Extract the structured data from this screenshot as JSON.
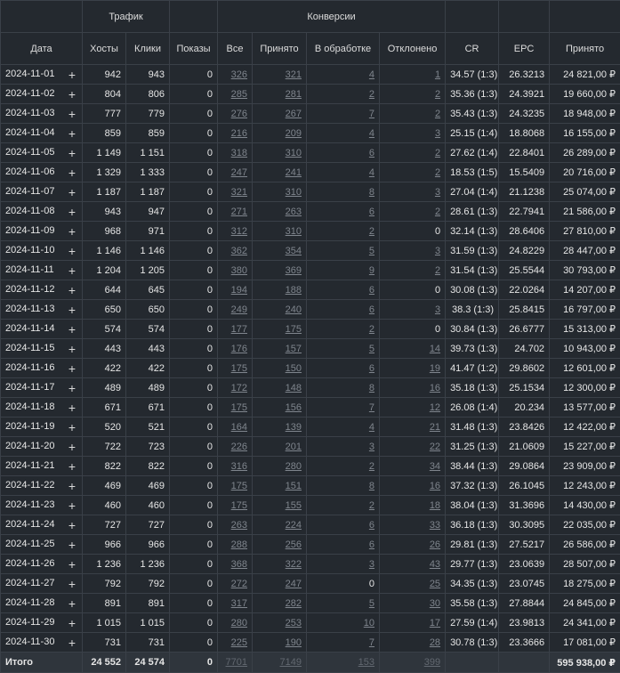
{
  "groups": {
    "traffic": "Трафик",
    "conversions": "Конверсии"
  },
  "columns": [
    "Дата",
    "Хосты",
    "Клики",
    "Показы",
    "Все",
    "Принято",
    "В обработке",
    "Отклонено",
    "CR",
    "EPC",
    "Принято"
  ],
  "rows": [
    {
      "date": "2024-11-01",
      "hosts": "942",
      "clicks": "943",
      "shows": "0",
      "all": "326",
      "accepted": "321",
      "pending": "4",
      "rejected": "1",
      "cr": "34.57 (1:3)",
      "epc": "26.3213",
      "revenue": "24 821,00 ₽"
    },
    {
      "date": "2024-11-02",
      "hosts": "804",
      "clicks": "806",
      "shows": "0",
      "all": "285",
      "accepted": "281",
      "pending": "2",
      "rejected": "2",
      "cr": "35.36 (1:3)",
      "epc": "24.3921",
      "revenue": "19 660,00 ₽"
    },
    {
      "date": "2024-11-03",
      "hosts": "777",
      "clicks": "779",
      "shows": "0",
      "all": "276",
      "accepted": "267",
      "pending": "7",
      "rejected": "2",
      "cr": "35.43 (1:3)",
      "epc": "24.3235",
      "revenue": "18 948,00 ₽"
    },
    {
      "date": "2024-11-04",
      "hosts": "859",
      "clicks": "859",
      "shows": "0",
      "all": "216",
      "accepted": "209",
      "pending": "4",
      "rejected": "3",
      "cr": "25.15 (1:4)",
      "epc": "18.8068",
      "revenue": "16 155,00 ₽"
    },
    {
      "date": "2024-11-05",
      "hosts": "1 149",
      "clicks": "1 151",
      "shows": "0",
      "all": "318",
      "accepted": "310",
      "pending": "6",
      "rejected": "2",
      "cr": "27.62 (1:4)",
      "epc": "22.8401",
      "revenue": "26 289,00 ₽"
    },
    {
      "date": "2024-11-06",
      "hosts": "1 329",
      "clicks": "1 333",
      "shows": "0",
      "all": "247",
      "accepted": "241",
      "pending": "4",
      "rejected": "2",
      "cr": "18.53 (1:5)",
      "epc": "15.5409",
      "revenue": "20 716,00 ₽"
    },
    {
      "date": "2024-11-07",
      "hosts": "1 187",
      "clicks": "1 187",
      "shows": "0",
      "all": "321",
      "accepted": "310",
      "pending": "8",
      "rejected": "3",
      "cr": "27.04 (1:4)",
      "epc": "21.1238",
      "revenue": "25 074,00 ₽"
    },
    {
      "date": "2024-11-08",
      "hosts": "943",
      "clicks": "947",
      "shows": "0",
      "all": "271",
      "accepted": "263",
      "pending": "6",
      "rejected": "2",
      "cr": "28.61 (1:3)",
      "epc": "22.7941",
      "revenue": "21 586,00 ₽"
    },
    {
      "date": "2024-11-09",
      "hosts": "968",
      "clicks": "971",
      "shows": "0",
      "all": "312",
      "accepted": "310",
      "pending": "2",
      "rejected": "0",
      "cr": "32.14 (1:3)",
      "epc": "28.6406",
      "revenue": "27 810,00 ₽"
    },
    {
      "date": "2024-11-10",
      "hosts": "1 146",
      "clicks": "1 146",
      "shows": "0",
      "all": "362",
      "accepted": "354",
      "pending": "5",
      "rejected": "3",
      "cr": "31.59 (1:3)",
      "epc": "24.8229",
      "revenue": "28 447,00 ₽"
    },
    {
      "date": "2024-11-11",
      "hosts": "1 204",
      "clicks": "1 205",
      "shows": "0",
      "all": "380",
      "accepted": "369",
      "pending": "9",
      "rejected": "2",
      "cr": "31.54 (1:3)",
      "epc": "25.5544",
      "revenue": "30 793,00 ₽"
    },
    {
      "date": "2024-11-12",
      "hosts": "644",
      "clicks": "645",
      "shows": "0",
      "all": "194",
      "accepted": "188",
      "pending": "6",
      "rejected": "0",
      "cr": "30.08 (1:3)",
      "epc": "22.0264",
      "revenue": "14 207,00 ₽"
    },
    {
      "date": "2024-11-13",
      "hosts": "650",
      "clicks": "650",
      "shows": "0",
      "all": "249",
      "accepted": "240",
      "pending": "6",
      "rejected": "3",
      "cr": "38.3 (1:3)",
      "epc": "25.8415",
      "revenue": "16 797,00 ₽"
    },
    {
      "date": "2024-11-14",
      "hosts": "574",
      "clicks": "574",
      "shows": "0",
      "all": "177",
      "accepted": "175",
      "pending": "2",
      "rejected": "0",
      "cr": "30.84 (1:3)",
      "epc": "26.6777",
      "revenue": "15 313,00 ₽"
    },
    {
      "date": "2024-11-15",
      "hosts": "443",
      "clicks": "443",
      "shows": "0",
      "all": "176",
      "accepted": "157",
      "pending": "5",
      "rejected": "14",
      "cr": "39.73 (1:3)",
      "epc": "24.702",
      "revenue": "10 943,00 ₽"
    },
    {
      "date": "2024-11-16",
      "hosts": "422",
      "clicks": "422",
      "shows": "0",
      "all": "175",
      "accepted": "150",
      "pending": "6",
      "rejected": "19",
      "cr": "41.47 (1:2)",
      "epc": "29.8602",
      "revenue": "12 601,00 ₽"
    },
    {
      "date": "2024-11-17",
      "hosts": "489",
      "clicks": "489",
      "shows": "0",
      "all": "172",
      "accepted": "148",
      "pending": "8",
      "rejected": "16",
      "cr": "35.18 (1:3)",
      "epc": "25.1534",
      "revenue": "12 300,00 ₽"
    },
    {
      "date": "2024-11-18",
      "hosts": "671",
      "clicks": "671",
      "shows": "0",
      "all": "175",
      "accepted": "156",
      "pending": "7",
      "rejected": "12",
      "cr": "26.08 (1:4)",
      "epc": "20.234",
      "revenue": "13 577,00 ₽"
    },
    {
      "date": "2024-11-19",
      "hosts": "520",
      "clicks": "521",
      "shows": "0",
      "all": "164",
      "accepted": "139",
      "pending": "4",
      "rejected": "21",
      "cr": "31.48 (1:3)",
      "epc": "23.8426",
      "revenue": "12 422,00 ₽"
    },
    {
      "date": "2024-11-20",
      "hosts": "722",
      "clicks": "723",
      "shows": "0",
      "all": "226",
      "accepted": "201",
      "pending": "3",
      "rejected": "22",
      "cr": "31.25 (1:3)",
      "epc": "21.0609",
      "revenue": "15 227,00 ₽"
    },
    {
      "date": "2024-11-21",
      "hosts": "822",
      "clicks": "822",
      "shows": "0",
      "all": "316",
      "accepted": "280",
      "pending": "2",
      "rejected": "34",
      "cr": "38.44 (1:3)",
      "epc": "29.0864",
      "revenue": "23 909,00 ₽"
    },
    {
      "date": "2024-11-22",
      "hosts": "469",
      "clicks": "469",
      "shows": "0",
      "all": "175",
      "accepted": "151",
      "pending": "8",
      "rejected": "16",
      "cr": "37.32 (1:3)",
      "epc": "26.1045",
      "revenue": "12 243,00 ₽"
    },
    {
      "date": "2024-11-23",
      "hosts": "460",
      "clicks": "460",
      "shows": "0",
      "all": "175",
      "accepted": "155",
      "pending": "2",
      "rejected": "18",
      "cr": "38.04 (1:3)",
      "epc": "31.3696",
      "revenue": "14 430,00 ₽"
    },
    {
      "date": "2024-11-24",
      "hosts": "727",
      "clicks": "727",
      "shows": "0",
      "all": "263",
      "accepted": "224",
      "pending": "6",
      "rejected": "33",
      "cr": "36.18 (1:3)",
      "epc": "30.3095",
      "revenue": "22 035,00 ₽"
    },
    {
      "date": "2024-11-25",
      "hosts": "966",
      "clicks": "966",
      "shows": "0",
      "all": "288",
      "accepted": "256",
      "pending": "6",
      "rejected": "26",
      "cr": "29.81 (1:3)",
      "epc": "27.5217",
      "revenue": "26 586,00 ₽"
    },
    {
      "date": "2024-11-26",
      "hosts": "1 236",
      "clicks": "1 236",
      "shows": "0",
      "all": "368",
      "accepted": "322",
      "pending": "3",
      "rejected": "43",
      "cr": "29.77 (1:3)",
      "epc": "23.0639",
      "revenue": "28 507,00 ₽"
    },
    {
      "date": "2024-11-27",
      "hosts": "792",
      "clicks": "792",
      "shows": "0",
      "all": "272",
      "accepted": "247",
      "pending": "0",
      "rejected": "25",
      "cr": "34.35 (1:3)",
      "epc": "23.0745",
      "revenue": "18 275,00 ₽"
    },
    {
      "date": "2024-11-28",
      "hosts": "891",
      "clicks": "891",
      "shows": "0",
      "all": "317",
      "accepted": "282",
      "pending": "5",
      "rejected": "30",
      "cr": "35.58 (1:3)",
      "epc": "27.8844",
      "revenue": "24 845,00 ₽"
    },
    {
      "date": "2024-11-29",
      "hosts": "1 015",
      "clicks": "1 015",
      "shows": "0",
      "all": "280",
      "accepted": "253",
      "pending": "10",
      "rejected": "17",
      "cr": "27.59 (1:4)",
      "epc": "23.9813",
      "revenue": "24 341,00 ₽"
    },
    {
      "date": "2024-11-30",
      "hosts": "731",
      "clicks": "731",
      "shows": "0",
      "all": "225",
      "accepted": "190",
      "pending": "7",
      "rejected": "28",
      "cr": "30.78 (1:3)",
      "epc": "23.3666",
      "revenue": "17 081,00 ₽"
    }
  ],
  "total": {
    "label": "Итого",
    "hosts": "24 552",
    "clicks": "24 574",
    "shows": "0",
    "all": "7701",
    "accepted": "7149",
    "pending": "153",
    "rejected": "399",
    "cr": "",
    "epc": "",
    "revenue": "595 938,00 ₽"
  },
  "icons": {
    "expand": "plus-icon"
  },
  "colors": {
    "background": "#24292f",
    "border": "#3a4048",
    "link": "#7f858d"
  }
}
